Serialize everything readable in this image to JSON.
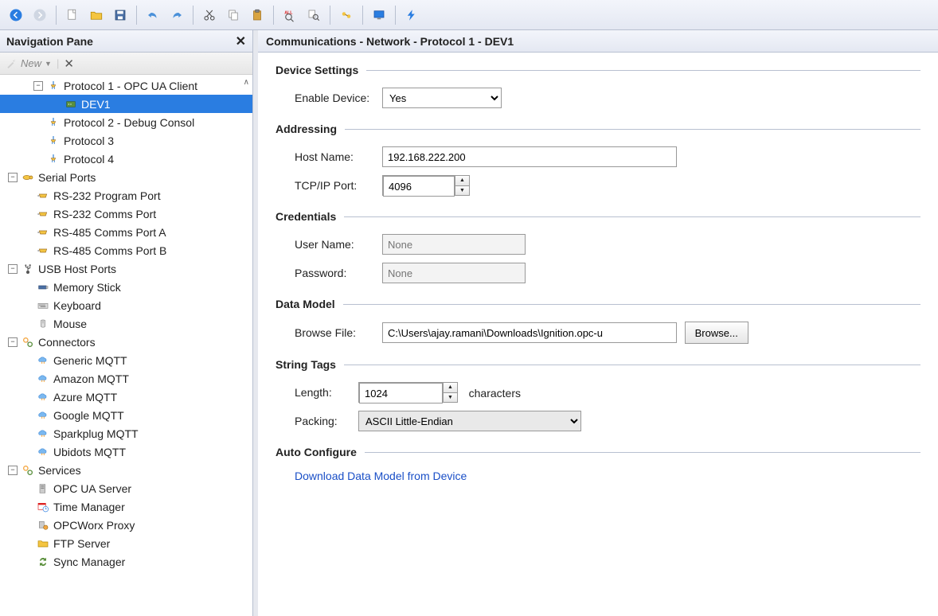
{
  "nav": {
    "title": "Navigation Pane",
    "new_label": "New",
    "tree": {
      "protocol1": "Protocol 1 - OPC UA Client",
      "dev1": "DEV1",
      "protocol2": "Protocol 2 - Debug Consol",
      "protocol3": "Protocol 3",
      "protocol4": "Protocol 4",
      "serial_ports": "Serial Ports",
      "rs232_prog": "RS-232 Program Port",
      "rs232_comms": "RS-232 Comms Port",
      "rs485_a": "RS-485 Comms Port A",
      "rs485_b": "RS-485 Comms Port B",
      "usb_host": "USB Host Ports",
      "memory_stick": "Memory Stick",
      "keyboard": "Keyboard",
      "mouse": "Mouse",
      "connectors": "Connectors",
      "generic_mqtt": "Generic MQTT",
      "amazon_mqtt": "Amazon MQTT",
      "azure_mqtt": "Azure MQTT",
      "google_mqtt": "Google MQTT",
      "sparkplug_mqtt": "Sparkplug MQTT",
      "ubidots_mqtt": "Ubidots MQTT",
      "services": "Services",
      "opc_ua_server": "OPC UA Server",
      "time_manager": "Time Manager",
      "opcworx_proxy": "OPCWorx Proxy",
      "ftp_server": "FTP Server",
      "sync_manager": "Sync Manager"
    }
  },
  "content": {
    "breadcrumb": "Communications - Network - Protocol 1 - DEV1",
    "sections": {
      "device_settings": "Device Settings",
      "addressing": "Addressing",
      "credentials": "Credentials",
      "data_model": "Data Model",
      "string_tags": "String Tags",
      "auto_configure": "Auto Configure"
    },
    "fields": {
      "enable_device_label": "Enable Device:",
      "enable_device_value": "Yes",
      "host_name_label": "Host Name:",
      "host_name_value": "192.168.222.200",
      "tcp_port_label": "TCP/IP Port:",
      "tcp_port_value": "4096",
      "user_name_label": "User Name:",
      "user_name_placeholder": "None",
      "password_label": "Password:",
      "password_placeholder": "None",
      "browse_file_label": "Browse File:",
      "browse_file_value": "C:\\Users\\ajay.ramani\\Downloads\\Ignition.opc-u",
      "browse_button": "Browse...",
      "length_label": "Length:",
      "length_value": "1024",
      "length_suffix": "characters",
      "packing_label": "Packing:",
      "packing_value": "ASCII Little-Endian",
      "download_link": "Download Data Model from Device"
    }
  }
}
